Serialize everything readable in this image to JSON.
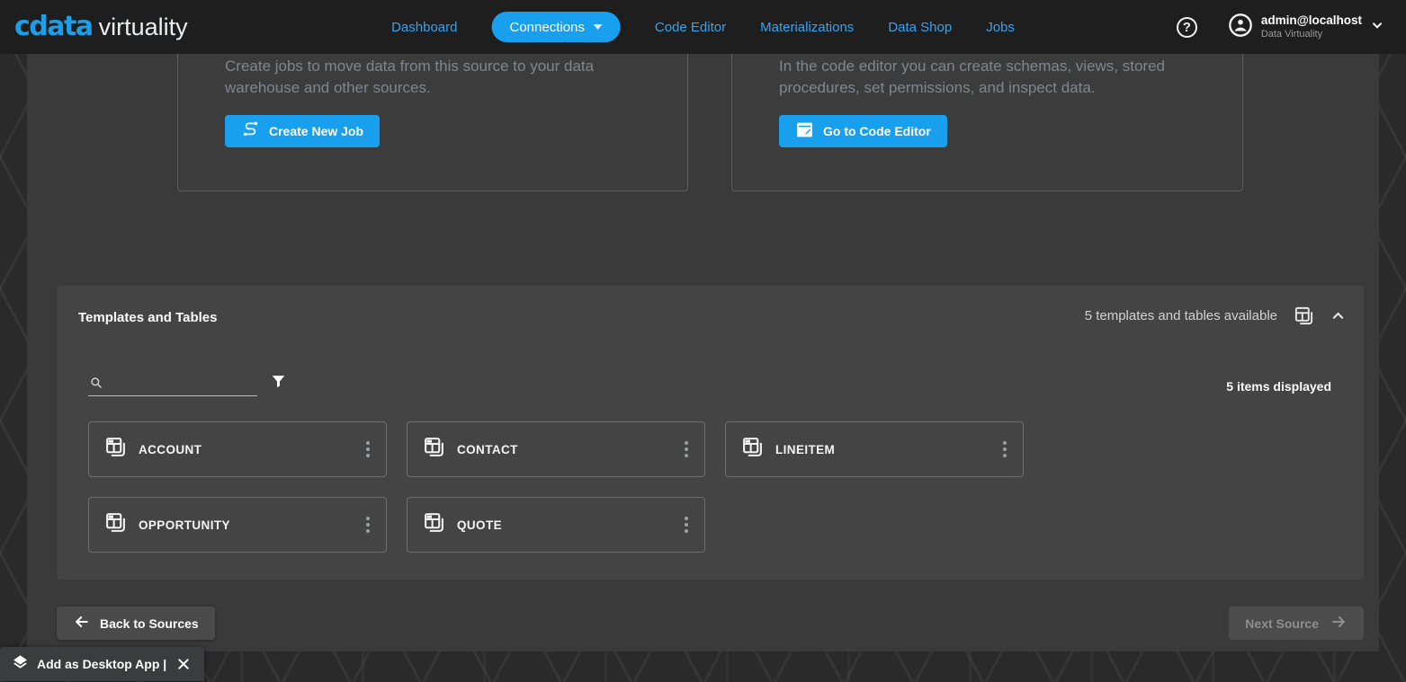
{
  "header": {
    "logo": {
      "brand": "cdata",
      "product": "virtuality"
    },
    "nav": [
      {
        "label": "Dashboard"
      },
      {
        "label": "Connections"
      },
      {
        "label": "Code Editor"
      },
      {
        "label": "Materializations"
      },
      {
        "label": "Data Shop"
      },
      {
        "label": "Jobs"
      }
    ],
    "help_glyph": "?",
    "user": {
      "email": "admin@localhost",
      "product": "Data Virtuality"
    }
  },
  "intro_cards": {
    "jobs": {
      "description": "Create jobs to move data from this source to your data warehouse and other sources.",
      "button_label": "Create New Job"
    },
    "code_editor": {
      "description": "In the code editor you can create schemas, views, stored procedures, set permissions, and inspect data.",
      "button_label": "Go to Code Editor"
    }
  },
  "templates_panel": {
    "title": "Templates and Tables",
    "available_text": "5 templates and tables available",
    "items_displayed_text": "5 items displayed",
    "search_value": "",
    "tables": [
      {
        "name": "ACCOUNT"
      },
      {
        "name": "CONTACT"
      },
      {
        "name": "LINEITEM"
      },
      {
        "name": "OPPORTUNITY"
      },
      {
        "name": "QUOTE"
      }
    ]
  },
  "footer": {
    "back_label": "Back to Sources",
    "next_label": "Next Source"
  },
  "desktop_banner": {
    "label": "Add as Desktop App |"
  },
  "colors": {
    "accent": "#18a0ee",
    "header_bg": "#1e1e1f",
    "page_bg": "#2a2a2b",
    "container_bg": "#3a3a3b",
    "panel_bg": "#444445"
  }
}
